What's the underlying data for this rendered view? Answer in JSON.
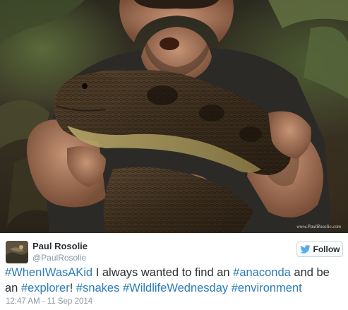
{
  "photo": {
    "alt": "Man holding anaconda",
    "watermark": "www.PaulRosolie.com"
  },
  "tweet": {
    "user": {
      "name": "Paul Rosolie",
      "handle": "@PaulRosolie",
      "avatar_icon": "avatar-photo"
    },
    "follow_button": {
      "label": "Follow",
      "icon": "twitter-bird-icon",
      "icon_color": "#55acee"
    },
    "text_segments": [
      {
        "text": "#WhenIWasAKid",
        "type": "hashtag"
      },
      {
        "text": " I always wanted to find an ",
        "type": "text"
      },
      {
        "text": "#anaconda",
        "type": "hashtag"
      },
      {
        "text": " and be an ",
        "type": "text"
      },
      {
        "text": "#explorer",
        "type": "hashtag"
      },
      {
        "text": "! ",
        "type": "text"
      },
      {
        "text": "#snakes",
        "type": "hashtag"
      },
      {
        "text": " ",
        "type": "text"
      },
      {
        "text": "#WildlifeWednesday",
        "type": "hashtag"
      },
      {
        "text": " ",
        "type": "text"
      },
      {
        "text": "#environment",
        "type": "hashtag"
      }
    ],
    "timestamp": "12:47 AM - 11 Sep 2014",
    "hashtag_color": "#2b7bb9"
  }
}
